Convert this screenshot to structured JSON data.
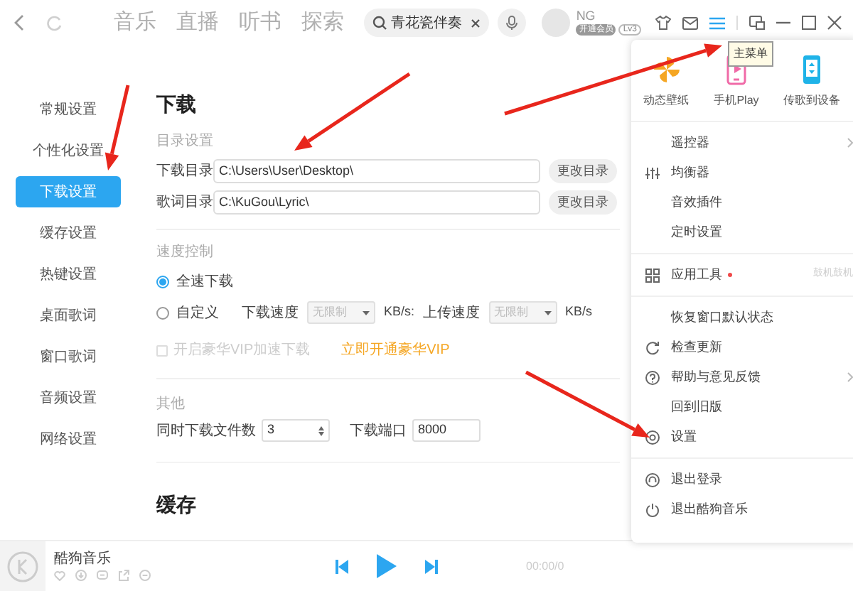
{
  "top_bar": {
    "nav_tabs": [
      {
        "label": "音乐"
      },
      {
        "label": "直播"
      },
      {
        "label": "听书"
      },
      {
        "label": "探索"
      }
    ],
    "search": {
      "value": "青花瓷伴奏"
    },
    "user": {
      "name": "NG",
      "vip_badge": "开通会员",
      "level_badge": "Lv3"
    },
    "tooltip": "主菜单"
  },
  "sidebar": {
    "items": [
      {
        "label": "常规设置",
        "selected": false
      },
      {
        "label": "个性化设置",
        "selected": false
      },
      {
        "label": "下载设置",
        "selected": true
      },
      {
        "label": "缓存设置",
        "selected": false
      },
      {
        "label": "热键设置",
        "selected": false
      },
      {
        "label": "桌面歌词",
        "selected": false
      },
      {
        "label": "窗口歌词",
        "selected": false
      },
      {
        "label": "音频设置",
        "selected": false
      },
      {
        "label": "网络设置",
        "selected": false
      }
    ]
  },
  "content": {
    "title": "下载",
    "directory": {
      "heading": "目录设置",
      "rows": [
        {
          "label": "下载目录",
          "value": "C:\\Users\\User\\Desktop\\",
          "button": "更改目录"
        },
        {
          "label": "歌词目录",
          "value": "C:\\KuGou\\Lyric\\",
          "button": "更改目录"
        }
      ]
    },
    "speed": {
      "heading": "速度控制",
      "options": [
        {
          "label": "全速下载",
          "selected": true
        },
        {
          "label": "自定义",
          "selected": false
        }
      ],
      "download_label": "下载速度",
      "download_value": "无限制",
      "download_unit": "KB/s:",
      "upload_label": "上传速度",
      "upload_value": "无限制",
      "upload_unit": "KB/s",
      "selects_disabled": true,
      "vip_checkbox": {
        "label": "开启豪华VIP加速下载",
        "checked": false,
        "disabled": true
      },
      "vip_link": "立即开通豪华VIP"
    },
    "other": {
      "heading": "其他",
      "files_label": "同时下载文件数",
      "files_value": "3",
      "port_label": "下载端口",
      "port_value": "8000"
    },
    "next_title": "缓存"
  },
  "player": {
    "title": "酷狗音乐",
    "time": "00:00/0"
  },
  "main_menu": {
    "tiles": [
      {
        "label": "动态壁纸",
        "kind": "pinwheel"
      },
      {
        "label": "手机Play",
        "kind": "phone-play"
      },
      {
        "label": "传歌到设备",
        "kind": "phone-transfer"
      }
    ],
    "groups": [
      [
        {
          "label": "遥控器",
          "kind": "none",
          "submenu": true,
          "dot": false
        },
        {
          "label": "均衡器",
          "kind": "equalizer",
          "submenu": false,
          "dot": false
        },
        {
          "label": "音效插件",
          "kind": "none",
          "submenu": false,
          "dot": false
        },
        {
          "label": "定时设置",
          "kind": "none",
          "submenu": false,
          "dot": false
        }
      ],
      [
        {
          "label": "应用工具",
          "kind": "apps",
          "submenu": false,
          "dot": true,
          "hint": "鼓机鼓机"
        }
      ],
      [
        {
          "label": "恢复窗口默认状态",
          "kind": "none",
          "submenu": false,
          "dot": false
        },
        {
          "label": "检查更新",
          "kind": "update",
          "submenu": false,
          "dot": false
        },
        {
          "label": "帮助与意见反馈",
          "kind": "help",
          "submenu": true,
          "dot": false
        },
        {
          "label": "回到旧版",
          "kind": "none",
          "submenu": false,
          "dot": false
        },
        {
          "label": "设置",
          "kind": "settings",
          "submenu": false,
          "dot": false
        }
      ],
      [
        {
          "label": "退出登录",
          "kind": "logout",
          "submenu": false,
          "dot": false
        },
        {
          "label": "退出酷狗音乐",
          "kind": "power",
          "submenu": false,
          "dot": false
        }
      ]
    ]
  }
}
